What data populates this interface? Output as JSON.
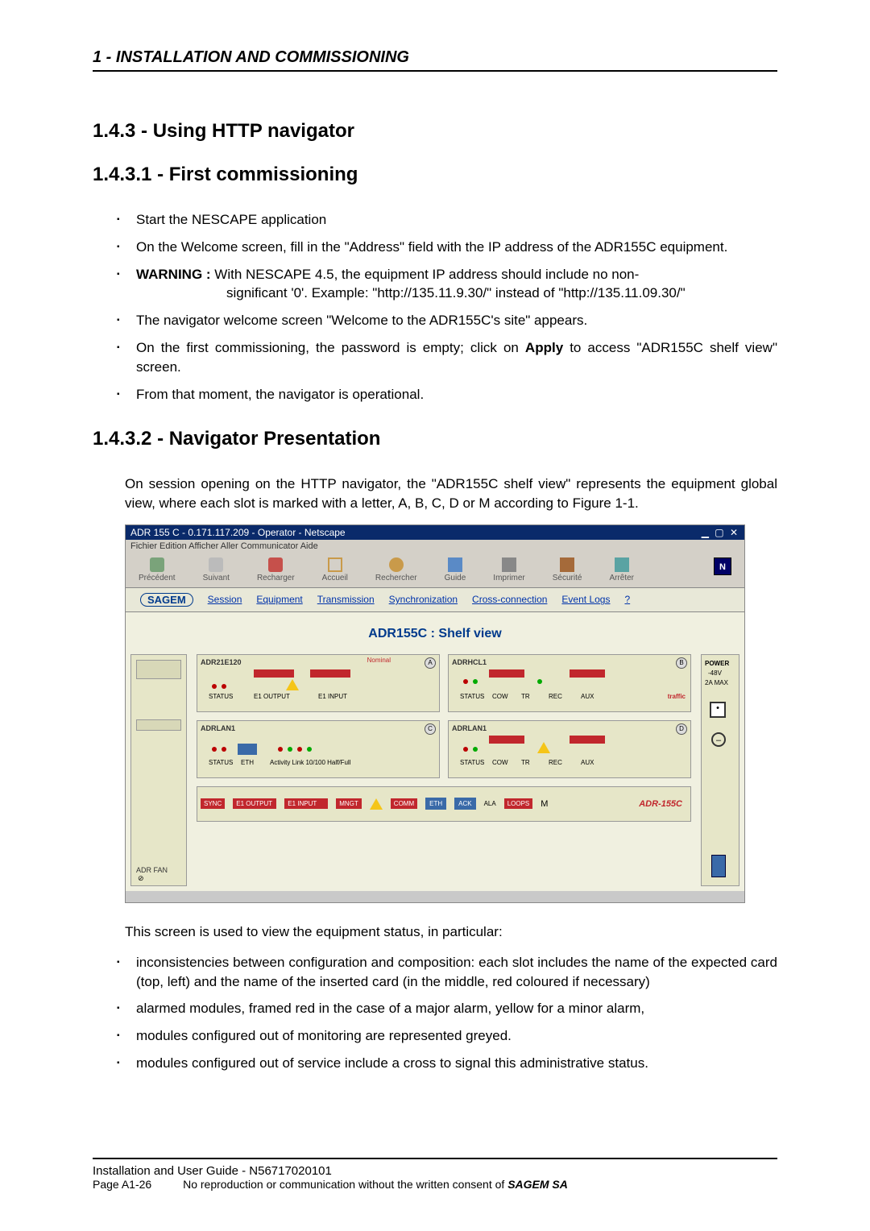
{
  "header": {
    "chapter": "1 - INSTALLATION AND COMMISSIONING"
  },
  "h3_1": "1.4.3   -  Using HTTP navigator",
  "h4_1": "1.4.3.1   -  First commissioning",
  "bullets1": {
    "b1": "Start the NESCAPE application",
    "b2": "On the Welcome screen, fill in the \"Address\" field with the IP address of the ADR155C equipment.",
    "b3_label": "WARNING :",
    "b3_text1": "With NESCAPE 4.5, the equipment IP address should include no non-",
    "b3_text2": "significant '0'. Example: \"http://135.11.9.30/\" instead of \"http://135.11.09.30/\"",
    "b4": "The navigator welcome screen \"Welcome to the ADR155C's site\" appears.",
    "b5a": "On the first commissioning, the password is empty; click on ",
    "b5_apply": "Apply",
    "b5b": " to access \"ADR155C shelf view\" screen.",
    "b6": "From that moment, the navigator is operational."
  },
  "h4_2": "1.4.3.2   -  Navigator Presentation",
  "para1": "On session opening on the HTTP navigator, the \"ADR155C shelf view\" represents the equipment global view, where each slot is marked with a letter, A, B, C, D or M according to Figure 1-1.",
  "screenshot": {
    "titlebar": "ADR 155 C - 0.171.117.209 - Operator - Netscape",
    "menu": "Fichier   Edition   Afficher   Aller   Communicator   Aide",
    "toolbar": [
      "Précédent",
      "Suivant",
      "Recharger",
      "Accueil",
      "Rechercher",
      "Guide",
      "Imprimer",
      "Sécurité",
      "Arrêter"
    ],
    "logo": "SAGEM",
    "tabs": [
      "Session",
      "Equipment",
      "Transmission",
      "Synchronization",
      "Cross-connection",
      "Event Logs",
      "?"
    ],
    "shelf_title": "ADR155C : Shelf view",
    "left_label": "ADR FAN",
    "cards": {
      "a": "ADR21E120",
      "b": "ADRHCL1",
      "c": "ADRLAN1",
      "d": "ADRLAN1"
    },
    "card_sub": {
      "status": "STATUS",
      "eth": "ETH",
      "cow": "COW",
      "tr": "TR",
      "rec": "REC",
      "aux": "AUX",
      "e1out": "E1 OUTPUT",
      "e1in": "E1 INPUT",
      "act": "Activity Link 10/100 Half/Full",
      "nominal": "Nominal"
    },
    "right": {
      "power": "POWER",
      "v": "-48V",
      "amp": "2A MAX"
    },
    "strip": {
      "sync": "SYNC",
      "e1o": "E1 OUTPUT",
      "e1i": "E1 INPUT",
      "mng": "MNGT",
      "comm": "COMM",
      "eth": "ETH",
      "ack": "ACK",
      "loops": "LOOPS",
      "brand": "ADR-155C",
      "m": "M",
      "ala": "ALA"
    }
  },
  "para2": "This screen is used to view the equipment status, in particular:",
  "bullets2": {
    "b1": "inconsistencies between configuration and composition: each slot includes the name of the expected card (top, left) and the name of the inserted card (in the middle, red coloured if necessary)",
    "b2": "alarmed modules, framed red in the case of a major alarm, yellow for a minor alarm,",
    "b3": "modules configured out of monitoring are represented greyed.",
    "b4": "modules configured out of service include a cross to signal this administrative status."
  },
  "footer": {
    "l1": "Installation and User Guide - N56717020101",
    "l2a": "Page A1-26",
    "l2b": "No reproduction or communication without the written consent of ",
    "l2c": "SAGEM SA"
  }
}
